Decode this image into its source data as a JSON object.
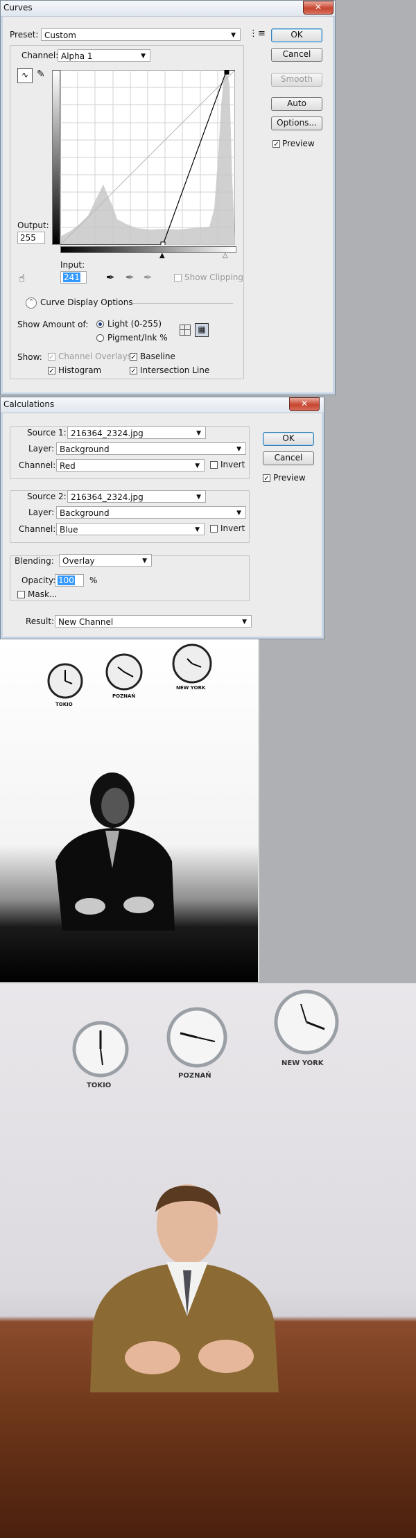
{
  "curves": {
    "title": "Curves",
    "preset_label": "Preset:",
    "preset_value": "Custom",
    "channel_label": "Channel:",
    "channel_value": "Alpha 1",
    "ok": "OK",
    "cancel": "Cancel",
    "smooth": "Smooth",
    "auto": "Auto",
    "options": "Options...",
    "preview": "Preview",
    "output_label": "Output:",
    "output_value": "255",
    "input_label": "Input:",
    "input_value": "241",
    "show_clipping": "Show Clipping",
    "curve_display_options": "Curve Display Options",
    "show_amount_label": "Show Amount of:",
    "light_label": "Light  (0-255)",
    "pigment_label": "Pigment/Ink %",
    "show_label": "Show:",
    "channel_overlays": "Channel Overlays",
    "baseline": "Baseline",
    "histogram": "Histogram",
    "intersection_line": "Intersection Line"
  },
  "calculations": {
    "title": "Calculations",
    "source1_label": "Source 1:",
    "source1_value": "216364_2324.jpg",
    "layer1_label": "Layer:",
    "layer1_value": "Background",
    "channel1_label": "Channel:",
    "channel1_value": "Red",
    "invert1": "Invert",
    "source2_label": "Source 2:",
    "source2_value": "216364_2324.jpg",
    "layer2_label": "Layer:",
    "layer2_value": "Background",
    "channel2_label": "Channel:",
    "channel2_value": "Blue",
    "invert2": "Invert",
    "blending_label": "Blending:",
    "blending_value": "Overlay",
    "opacity_label": "Opacity:",
    "opacity_value": "100",
    "opacity_unit": "%",
    "mask_label": "Mask...",
    "result_label": "Result:",
    "result_value": "New Channel",
    "ok": "OK",
    "cancel": "Cancel",
    "preview": "Preview"
  },
  "photo_bw": {
    "clock1": "TOKIO",
    "clock2": "POZNAŃ",
    "clock3": "NEW YORK"
  },
  "photo_color": {
    "clock1": "TOKIO",
    "clock2": "POZNAŃ",
    "clock3": "NEW YORK"
  }
}
